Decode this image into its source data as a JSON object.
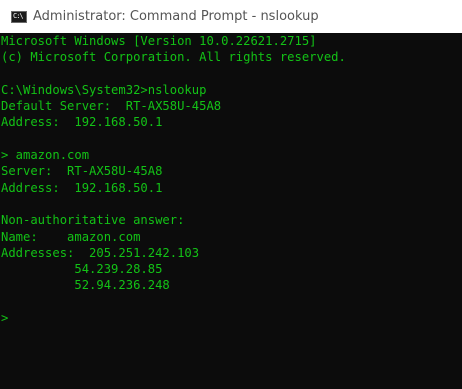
{
  "window": {
    "title": "Administrator: Command Prompt - nslookup",
    "icon": "cmd-icon",
    "icon_prompt_text": "C:\\"
  },
  "colors": {
    "console_background": "#0c0c0c",
    "console_text": "#13c216",
    "titlebar_background": "#ffffff",
    "title_text": "#555555"
  },
  "console": {
    "lines": [
      "Microsoft Windows [Version 10.0.22621.2715]",
      "(c) Microsoft Corporation. All rights reserved.",
      "",
      "C:\\Windows\\System32>nslookup",
      "Default Server:  RT-AX58U-45A8",
      "Address:  192.168.50.1",
      "",
      "> amazon.com",
      "Server:  RT-AX58U-45A8",
      "Address:  192.168.50.1",
      "",
      "Non-authoritative answer:",
      "Name:    amazon.com",
      "Addresses:  205.251.242.103",
      "          54.239.28.85",
      "          52.94.236.248",
      "",
      ">"
    ]
  }
}
